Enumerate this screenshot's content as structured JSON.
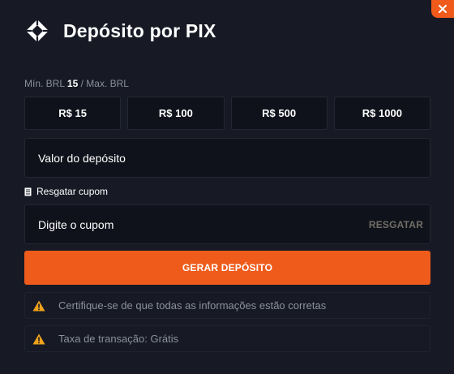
{
  "modal": {
    "title": "Depósito por PIX",
    "close_icon": "close-icon",
    "logo_icon": "pix-logo-icon"
  },
  "limits": {
    "min_label": "Mín. BRL",
    "min_value": "15",
    "max_label": "/ Max. BRL"
  },
  "amounts": [
    {
      "label": "R$ 15"
    },
    {
      "label": "R$ 100"
    },
    {
      "label": "R$ 500"
    },
    {
      "label": "R$ 1000"
    }
  ],
  "deposit_field": {
    "placeholder": "Valor do depósito"
  },
  "coupon": {
    "label": "Resgatar cupom",
    "placeholder": "Digite o cupom",
    "redeem_label": "RESGATAR"
  },
  "submit": {
    "label": "GERAR DEPÓSITO"
  },
  "notices": [
    {
      "text": "Certifique-se de que todas as informações estão corretas",
      "icon": "warning-icon"
    },
    {
      "text": "Taxa de transação: Grátis",
      "icon": "warning-icon"
    }
  ],
  "colors": {
    "accent": "#ee5b1b",
    "background": "#171a25",
    "warning": "#f0a31b"
  }
}
